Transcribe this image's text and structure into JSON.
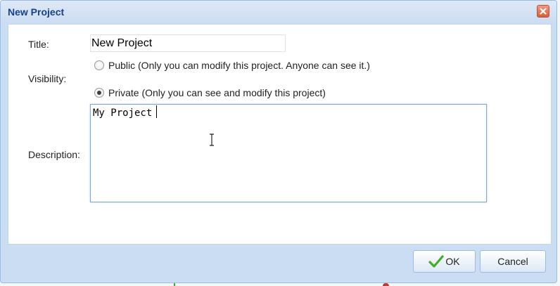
{
  "dialog": {
    "title": "New Project",
    "close_icon": "close-x-icon"
  },
  "form": {
    "title_label": "Title:",
    "title_value": "New Project",
    "visibility_label": "Visibility:",
    "visibility_options": [
      {
        "label": "Public (Only you can modify this project. Anyone can see it.)",
        "checked": false
      },
      {
        "label": "Private (Only you can see and modify this project)",
        "checked": true
      }
    ],
    "description_label": "Description:",
    "description_value": "My Project"
  },
  "footer": {
    "ok_label": "OK",
    "ok_icon": "checkmark-icon",
    "cancel_label": "Cancel"
  },
  "colors": {
    "title_text": "#15428b",
    "accent_border": "#99bbe8",
    "close_button": "#db5a38",
    "ok_check": "#3fae29"
  }
}
